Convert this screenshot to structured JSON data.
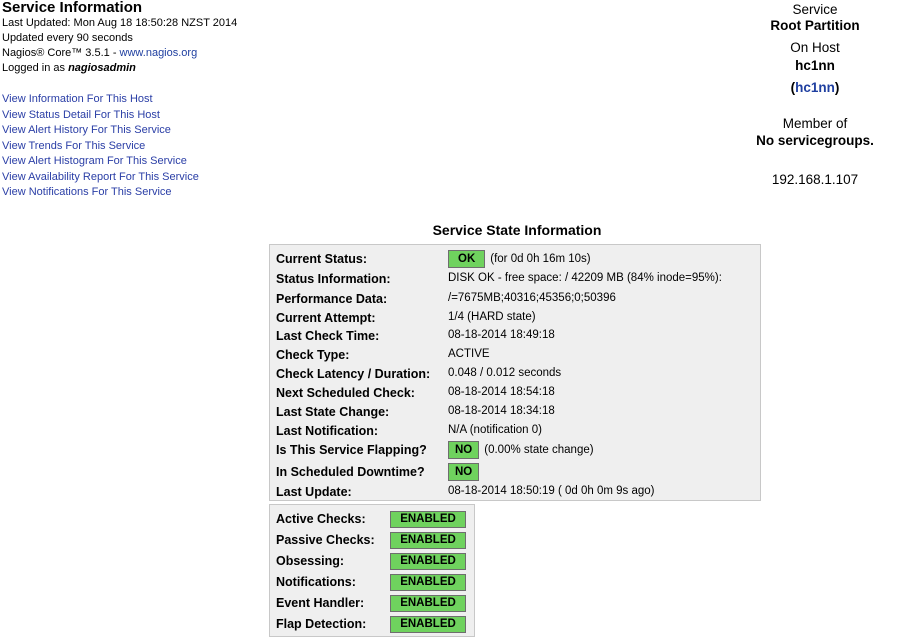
{
  "header": {
    "title": "Service Information",
    "last_updated": "Last Updated: Mon Aug 18 18:50:28 NZST 2014",
    "update_interval": "Updated every 90 seconds",
    "version_prefix": "Nagios® Core™ 3.5.1 - ",
    "version_link": "www.nagios.org",
    "logged_in_prefix": "Logged in as ",
    "logged_in_user": "nagiosadmin"
  },
  "nav_links": [
    "View Information For This Host",
    "View Status Detail For This Host",
    "View Alert History For This Service",
    "View Trends For This Service",
    "View Alert Histogram For This Service",
    "View Availability Report For This Service",
    "View Notifications For This Service"
  ],
  "service": {
    "service_label": "Service",
    "service_name": "Root Partition",
    "host_label": "On Host",
    "host_name": "hc1nn",
    "host_alias": "(hc1nn)",
    "member_label": "Member of",
    "member_value": "No servicegroups.",
    "address": "192.168.1.107"
  },
  "state_info": {
    "title": "Service State Information",
    "rows": [
      {
        "label": "Current Status:",
        "badge": "OK",
        "value": "(for 0d 0h 16m 10s)"
      },
      {
        "label": "Status Information:",
        "value": "DISK OK - free space: / 42209 MB (84% inode=95%):"
      },
      {
        "label": "Performance Data:",
        "value": "/=7675MB;40316;45356;0;50396"
      },
      {
        "label": "Current Attempt:",
        "value": "1/4  (HARD state)"
      },
      {
        "label": "Last Check Time:",
        "value": "08-18-2014 18:49:18"
      },
      {
        "label": "Check Type:",
        "value": "ACTIVE"
      },
      {
        "label": "Check Latency / Duration:",
        "value": "0.048 / 0.012 seconds"
      },
      {
        "label": "Next Scheduled Check:",
        "value": "08-18-2014 18:54:18"
      },
      {
        "label": "Last State Change:",
        "value": "08-18-2014 18:34:18"
      },
      {
        "label": "Last Notification:",
        "value": "N/A (notification 0)"
      },
      {
        "label": "Is This Service Flapping?",
        "badge": "NO",
        "value": "(0.00% state change)"
      },
      {
        "label": "In Scheduled Downtime?",
        "badge": "NO",
        "value": ""
      },
      {
        "label": "Last Update:",
        "value": "08-18-2014 18:50:19  ( 0d 0h 0m 9s ago)"
      }
    ]
  },
  "checks": [
    {
      "label": "Active Checks:",
      "status": "ENABLED"
    },
    {
      "label": "Passive Checks:",
      "status": "ENABLED"
    },
    {
      "label": "Obsessing:",
      "status": "ENABLED"
    },
    {
      "label": "Notifications:",
      "status": "ENABLED"
    },
    {
      "label": "Event Handler:",
      "status": "ENABLED"
    },
    {
      "label": "Flap Detection:",
      "status": "ENABLED"
    }
  ],
  "colors": {
    "ok_green": "#6fd25e",
    "link_blue": "#2a3ea6",
    "panel_gray": "#efefef"
  }
}
